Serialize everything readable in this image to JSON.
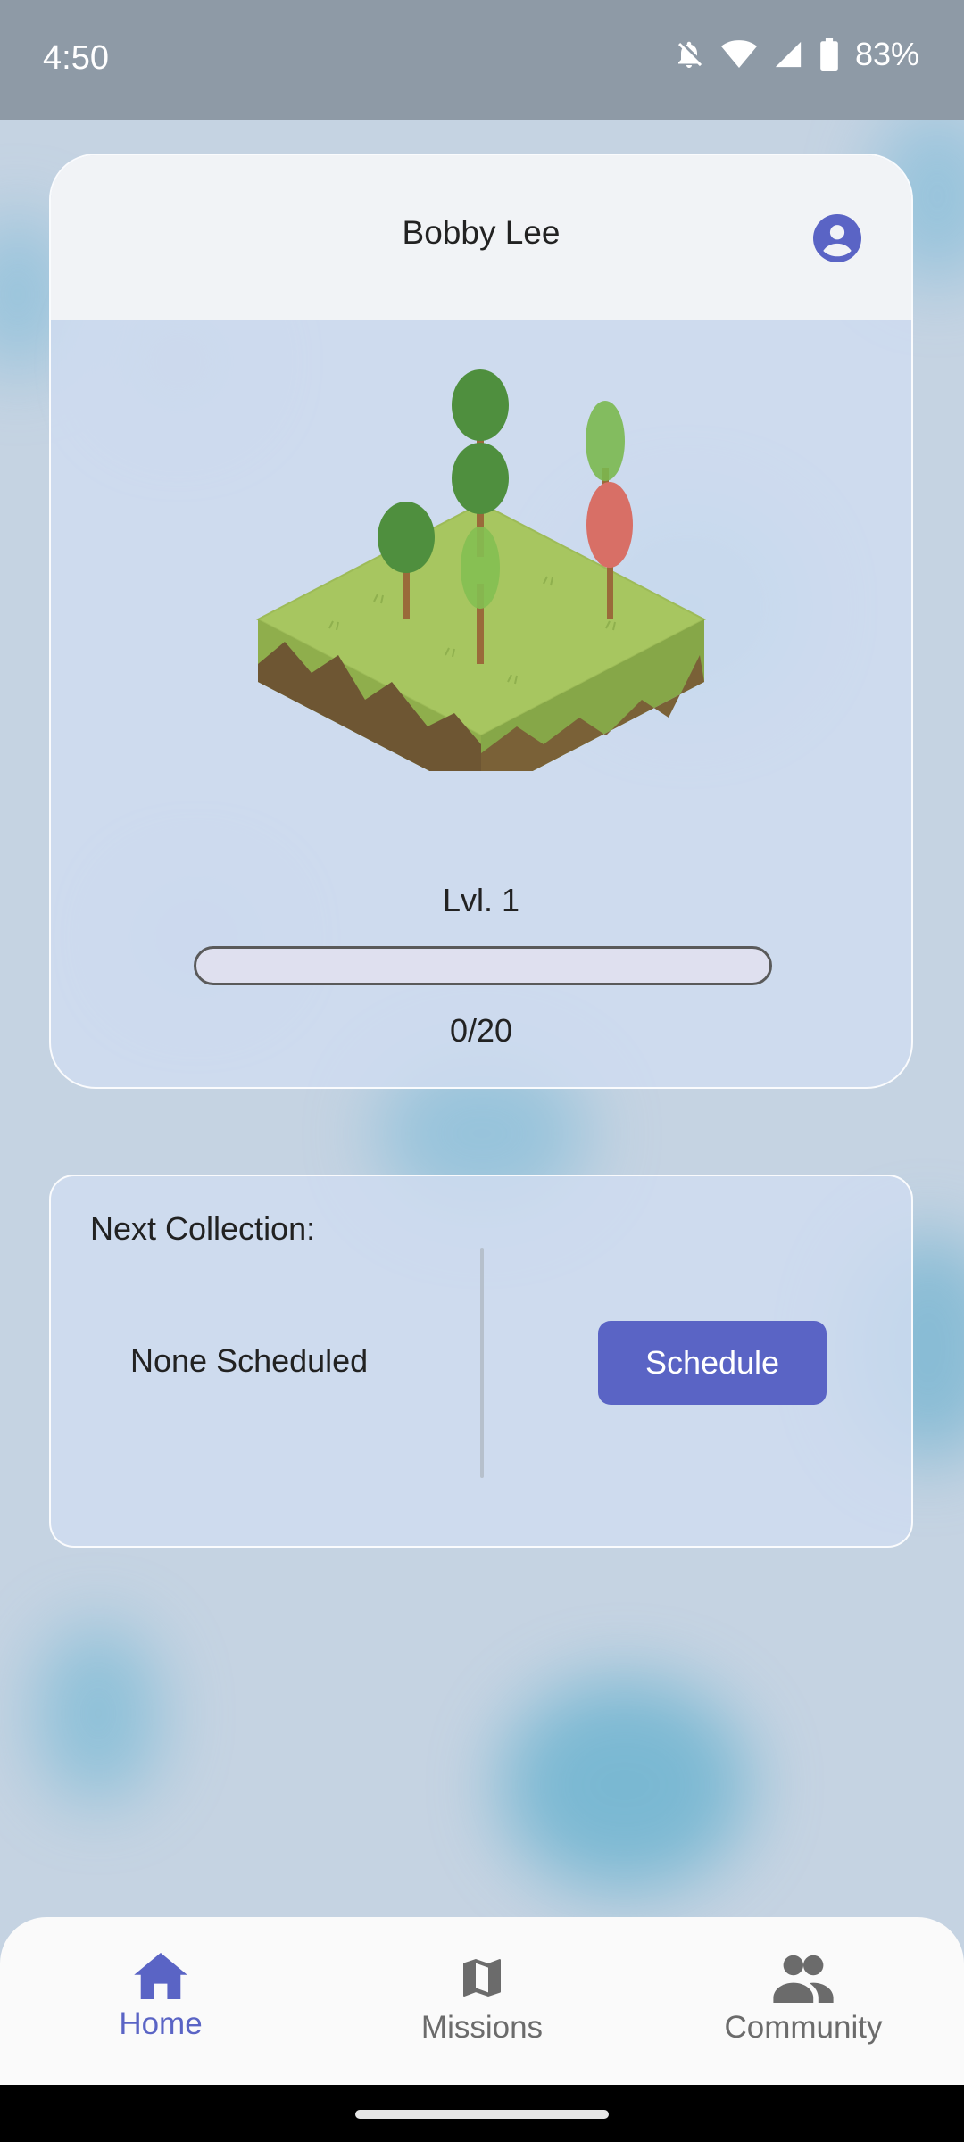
{
  "status_bar": {
    "time": "4:50",
    "battery_percent": "83%",
    "icons": [
      "bell-off-icon",
      "wifi-icon",
      "signal-icon",
      "battery-icon"
    ]
  },
  "profile": {
    "user_name": "Bobby Lee",
    "avatar_icon": "account-circle-icon",
    "level_label": "Lvl. 1",
    "progress": {
      "current": 0,
      "max": 20,
      "label": "0/20"
    },
    "island_image": "isometric-grass-island-with-trees"
  },
  "collection": {
    "title": "Next Collection:",
    "status": "None Scheduled",
    "schedule_button": "Schedule"
  },
  "nav": {
    "items": [
      {
        "label": "Home",
        "icon": "home-icon",
        "active": true
      },
      {
        "label": "Missions",
        "icon": "map-icon",
        "active": false
      },
      {
        "label": "Community",
        "icon": "group-icon",
        "active": false
      }
    ]
  },
  "colors": {
    "accent": "#5a64c5",
    "status_bar": "#8e9aa6",
    "card_header": "#f1f3f6",
    "nav_inactive": "#6b6b6b"
  }
}
